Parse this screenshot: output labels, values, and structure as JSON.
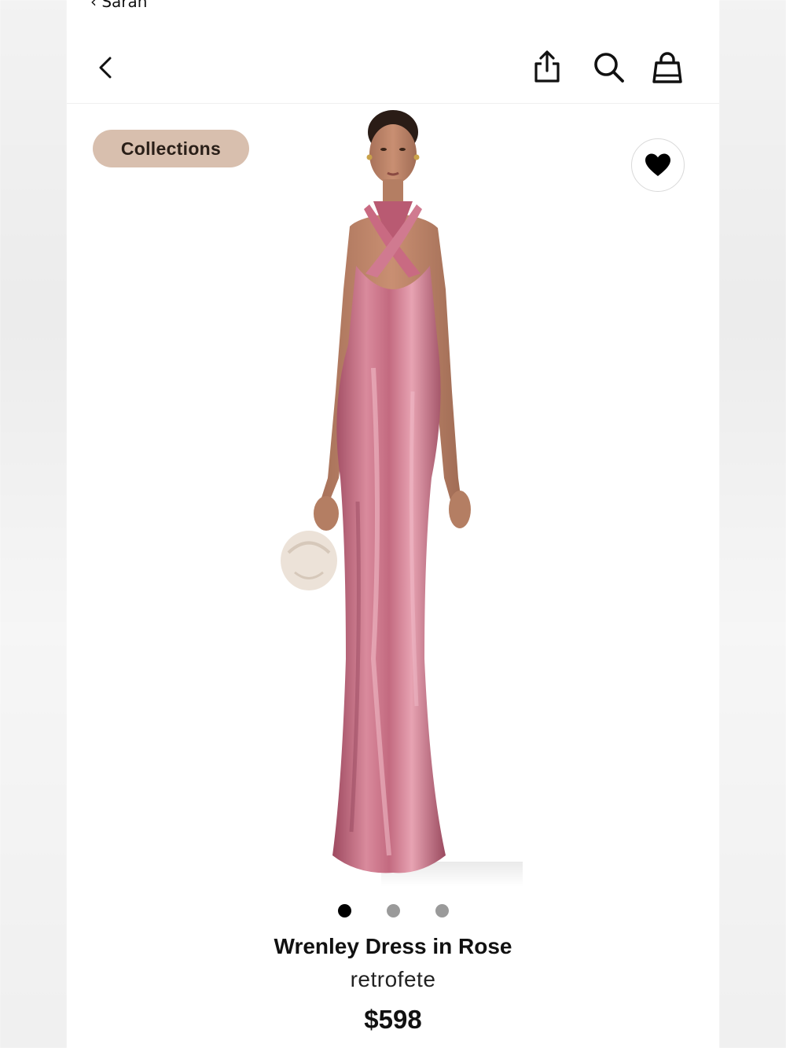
{
  "status": {
    "top_cut_text": "‹ Sarah"
  },
  "nav": {
    "back_icon": "chevron-left-icon",
    "share_icon": "share-icon",
    "search_icon": "search-icon",
    "bag_icon": "shopping-bag-icon"
  },
  "badge": {
    "label": "Collections",
    "color": "#d8bfae"
  },
  "favorite": {
    "icon": "heart-icon",
    "active": true
  },
  "gallery": {
    "image_count": 3,
    "active_index": 0
  },
  "product": {
    "name": "Wrenley Dress in Rose",
    "brand": "retrofete",
    "price": "$598",
    "dress_color": "#c36a80"
  }
}
